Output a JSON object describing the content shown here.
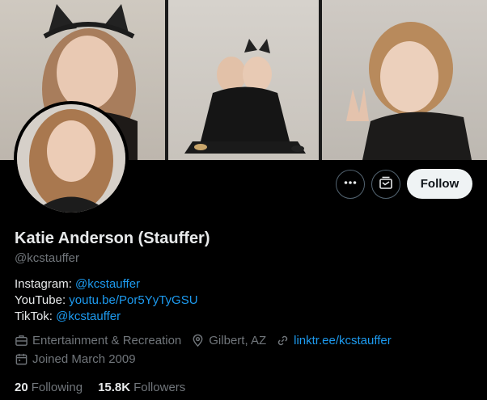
{
  "profile": {
    "name": "Katie Anderson (Stauffer)",
    "handle": "@kcstauffer",
    "bio": {
      "instagram_label": "Instagram:",
      "instagram_value": "@kcstauffer",
      "youtube_label": "YouTube:",
      "youtube_value": "youtu.be/Por5YyTyGSU",
      "tiktok_label": "TikTok:",
      "tiktok_value": "@kcstauffer"
    },
    "category": "Entertainment & Recreation",
    "location": "Gilbert, AZ",
    "website": "linktr.ee/kcstauffer",
    "joined": "Joined March 2009",
    "following_count": "20",
    "following_label": "Following",
    "followers_count": "15.8K",
    "followers_label": "Followers"
  },
  "actions": {
    "more_icon": "more-horizontal-icon",
    "subscribe_icon": "subscribe-icon",
    "follow_label": "Follow"
  },
  "colors": {
    "background": "#000000",
    "text_primary": "#e7e9ea",
    "text_secondary": "#71767b",
    "link": "#1d9bf0",
    "follow_bg": "#eff3f4",
    "button_border": "#536471"
  }
}
